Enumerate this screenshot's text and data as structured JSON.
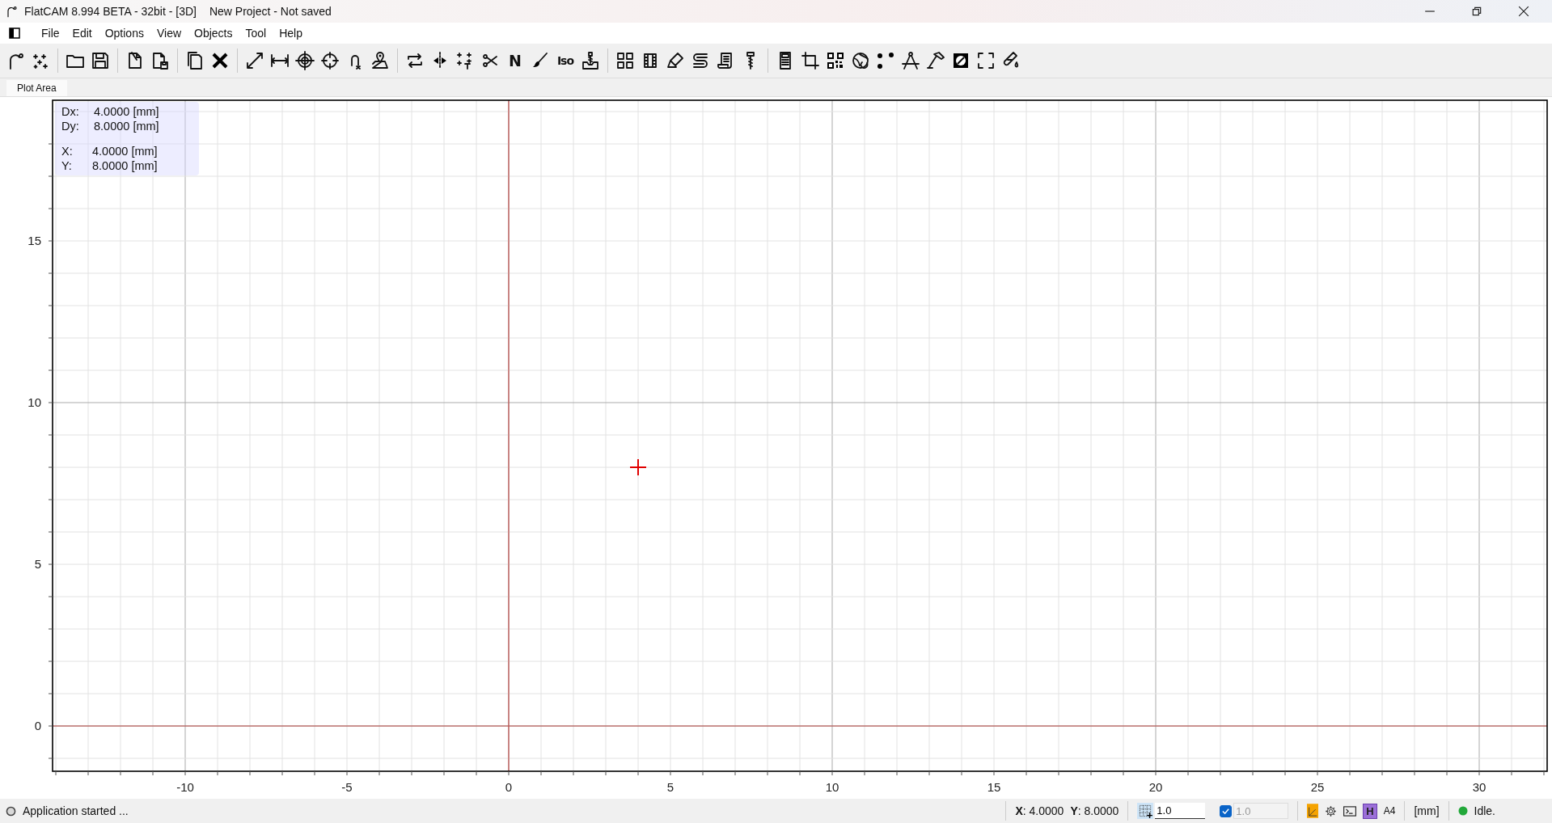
{
  "window": {
    "title": "FlatCAM 8.994 BETA - 32bit - [3D]",
    "subtitle": "New Project - Not saved"
  },
  "menu": [
    "File",
    "Edit",
    "Options",
    "View",
    "Objects",
    "Tool",
    "Help"
  ],
  "toolbar_glyphs": [
    "N",
    "Iso"
  ],
  "tabs": [
    {
      "label": "Plot Area",
      "selected": true
    }
  ],
  "readout": {
    "delta": [
      {
        "label": "Dx:",
        "value": "4.0000 [mm]"
      },
      {
        "label": "Dy:",
        "value": "8.0000 [mm]"
      }
    ],
    "position": [
      {
        "label": "X:",
        "value": "4.0000 [mm]"
      },
      {
        "label": "Y:",
        "value": "8.0000 [mm]"
      }
    ]
  },
  "plot": {
    "x_ticks": [
      "-10",
      "-5",
      "0",
      "5",
      "10",
      "15",
      "20",
      "25",
      "30"
    ],
    "y_ticks": [
      "15",
      "10",
      "5",
      "0"
    ]
  },
  "status_bar": {
    "message": "Application started ...",
    "x_label": "X",
    "x_value": ": 4.0000",
    "y_label": "Y",
    "y_value": ": 8.0000",
    "grid_value": "1.0",
    "snap_checked": true,
    "snap_value": "1.0",
    "snap_disabled": true,
    "badge": "H",
    "paper": "A4",
    "units": "[mm]",
    "state": "Idle."
  }
}
